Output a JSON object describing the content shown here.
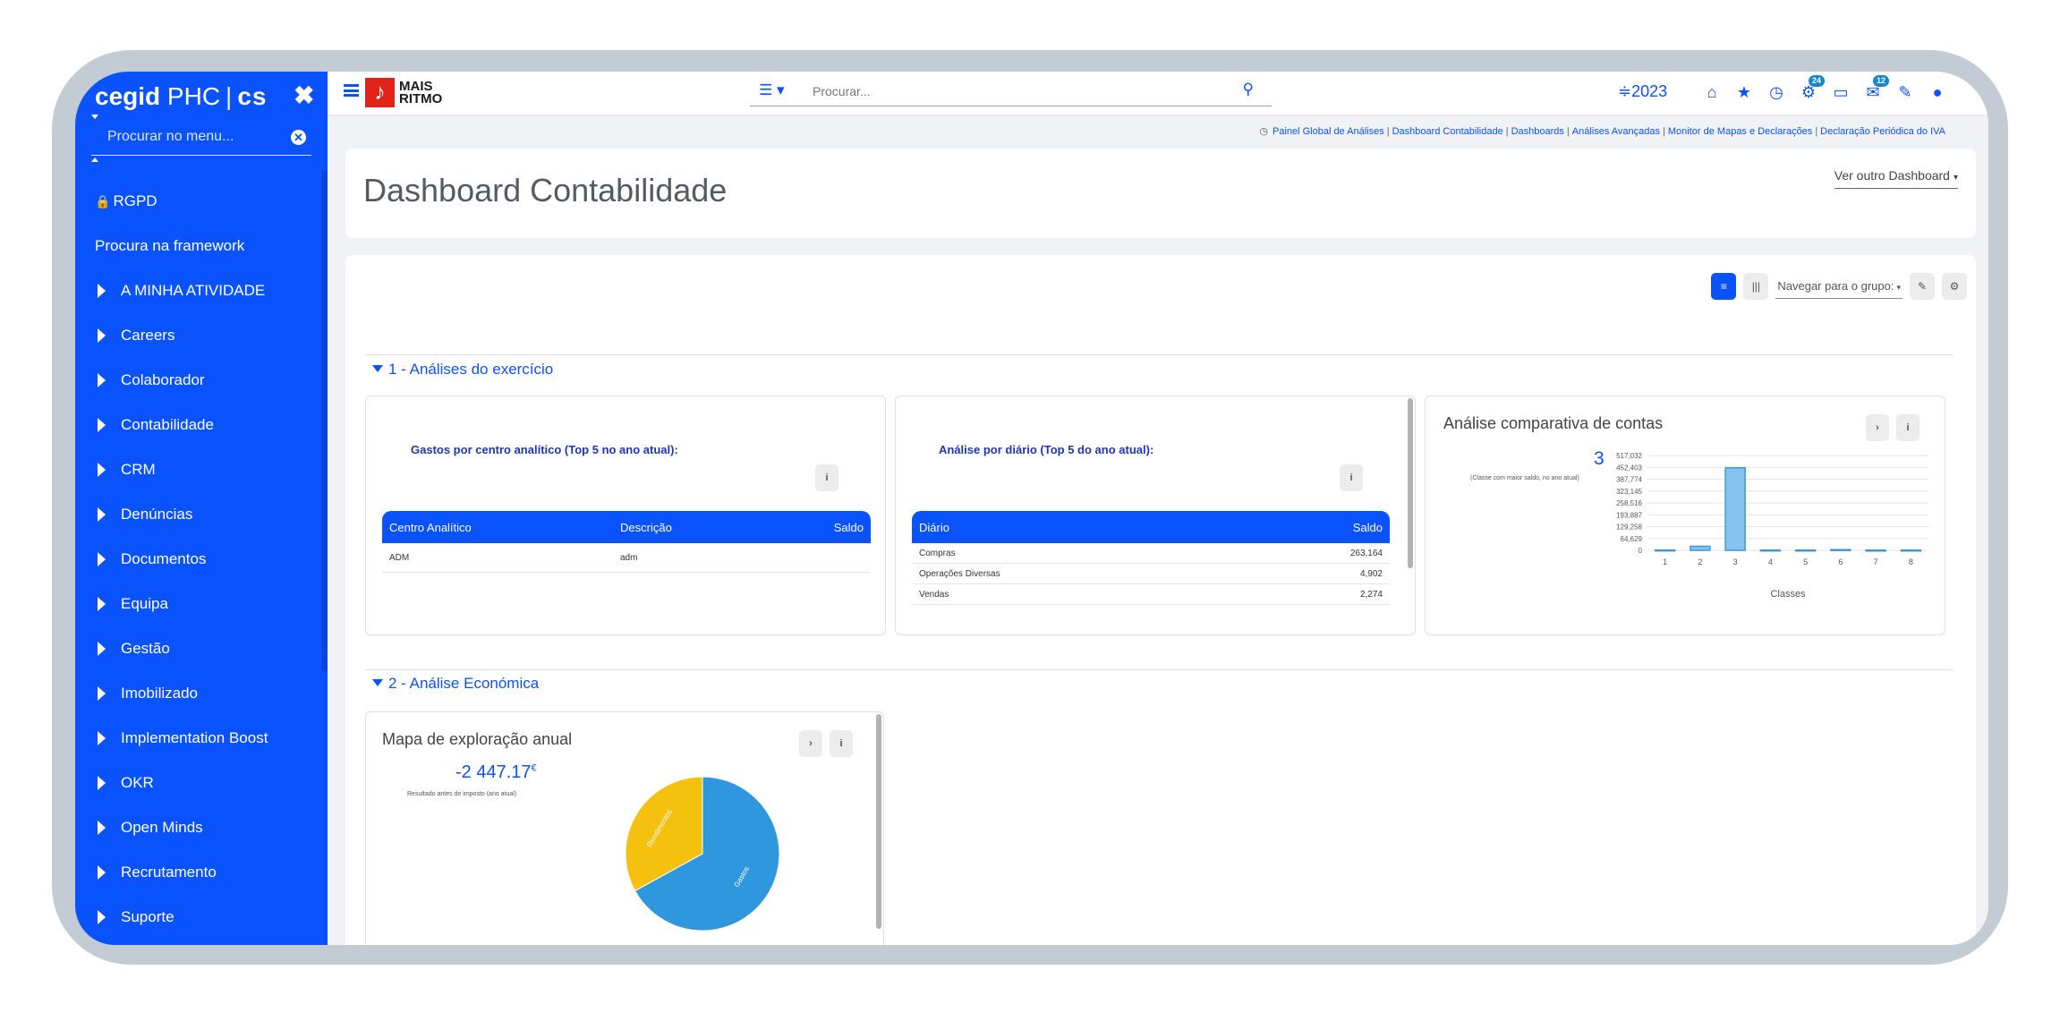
{
  "sidebar": {
    "brand": {
      "name_bold": "cegid",
      "name_rest": "PHC",
      "separator": "|",
      "suffix": "cs"
    },
    "close_glyph": "✖",
    "search": {
      "placeholder": "Procurar no menu...",
      "clear_glyph": "✕"
    },
    "items": [
      {
        "label": "RGPD",
        "icon": "lock-icon",
        "expandable": false
      },
      {
        "label": "Procura na framework",
        "expandable": false
      },
      {
        "label": "A MINHA ATIVIDADE",
        "expandable": true
      },
      {
        "label": "Careers",
        "expandable": true
      },
      {
        "label": "Colaborador",
        "expandable": true
      },
      {
        "label": "Contabilidade",
        "expandable": true
      },
      {
        "label": "CRM",
        "expandable": true
      },
      {
        "label": "Denúncias",
        "expandable": true
      },
      {
        "label": "Documentos",
        "expandable": true
      },
      {
        "label": "Equipa",
        "expandable": true
      },
      {
        "label": "Gestão",
        "expandable": true
      },
      {
        "label": "Imobilizado",
        "expandable": true
      },
      {
        "label": "Implementation Boost",
        "expandable": true
      },
      {
        "label": "OKR",
        "expandable": true
      },
      {
        "label": "Open Minds",
        "expandable": true
      },
      {
        "label": "Recrutamento",
        "expandable": true
      },
      {
        "label": "Suporte",
        "expandable": true
      }
    ]
  },
  "topbar": {
    "logo": {
      "mark": "♪",
      "line1": "MAIS",
      "line2": "RITMO"
    },
    "search": {
      "placeholder": "Procurar...",
      "list_glyph": "☰ ▾",
      "search_glyph": "🔍"
    },
    "year": "≑2023",
    "icons": [
      {
        "name": "home-icon",
        "glyph": "⌂",
        "badge": ""
      },
      {
        "name": "star-icon",
        "glyph": "★",
        "badge": ""
      },
      {
        "name": "clock-icon",
        "glyph": "◷",
        "badge": ""
      },
      {
        "name": "gears-icon",
        "glyph": "⚙",
        "badge": "24"
      },
      {
        "name": "calendar-icon",
        "glyph": "▭",
        "badge": ""
      },
      {
        "name": "chat-icon",
        "glyph": "✉",
        "badge": "12"
      },
      {
        "name": "wrench-icon",
        "glyph": "✎",
        "badge": ""
      },
      {
        "name": "lightbulb-icon",
        "glyph": "●",
        "badge": ""
      }
    ]
  },
  "breadcrumb": {
    "clock_glyph": "◷",
    "items": [
      "Painel Global de Análises",
      "Dashboard Contabilidade",
      "Dashboards",
      "Análises Avançadas",
      "Monitor de Mapas e Declarações",
      "Declaração Periódica do IVA"
    ],
    "separator": "|"
  },
  "header": {
    "title": "Dashboard Contabilidade",
    "other_dashboard": "Ver outro Dashboard",
    "caret": "▾"
  },
  "toolbar": {
    "list_glyph": "≡",
    "columns_glyph": "|||",
    "group_label": "Navegar para o grupo:",
    "caret": "▾",
    "edit_glyph": "✎",
    "settings_glyph": "⚙"
  },
  "sections": [
    {
      "title": "1 - Análises do exercício"
    },
    {
      "title": "2 - Análise Económica"
    }
  ],
  "panels": {
    "gastos": {
      "subtitle": "Gastos por centro analítico (Top 5 no ano atual):",
      "info_glyph": "i",
      "columns": [
        "Centro Analítico",
        "Descrição",
        "Saldo"
      ],
      "rows": [
        [
          "ADM",
          "adm",
          ""
        ]
      ]
    },
    "diario": {
      "subtitle": "Análise por diário (Top 5 do ano atual):",
      "info_glyph": "i",
      "columns": [
        "Diário",
        "Saldo"
      ],
      "rows": [
        [
          "Compras",
          "263,164"
        ],
        [
          "Operações Diversas",
          "4,902"
        ],
        [
          "Vendas",
          "2,274"
        ]
      ]
    },
    "comparativa": {
      "title": "Análise comparativa de contas",
      "kpi_value": "3",
      "kpi_sub": "(Classe com maior saldo, no ano atual)",
      "next_glyph": "›",
      "info_glyph": "i"
    },
    "mapa": {
      "title": "Mapa de exploração anual",
      "kpi_value": "-2 447.17",
      "kpi_unit": "€",
      "kpi_sub": "Resultado antes de imposto (ano atual)",
      "next_glyph": "›",
      "info_glyph": "i"
    }
  },
  "chart_data": [
    {
      "type": "bar",
      "categories": [
        "1",
        "2",
        "3",
        "4",
        "5",
        "6",
        "7",
        "8"
      ],
      "values": [
        1800,
        22000,
        450000,
        1500,
        1500,
        4000,
        1200,
        1500
      ],
      "ytick_labels": [
        "0",
        "64,629",
        "129,258",
        "193,887",
        "258,516",
        "323,145",
        "387,774",
        "452,403",
        "517,032"
      ],
      "ylim": [
        0,
        517032
      ],
      "xlabel": "Classes",
      "ylabel": "",
      "color": "#87c3ec",
      "stroke": "#3a9ad9"
    },
    {
      "type": "pie",
      "labels": [
        "Gastos",
        "Rendimentos"
      ],
      "values": [
        67,
        33
      ],
      "colors": [
        "#2f97de",
        "#f4c10f"
      ]
    }
  ]
}
